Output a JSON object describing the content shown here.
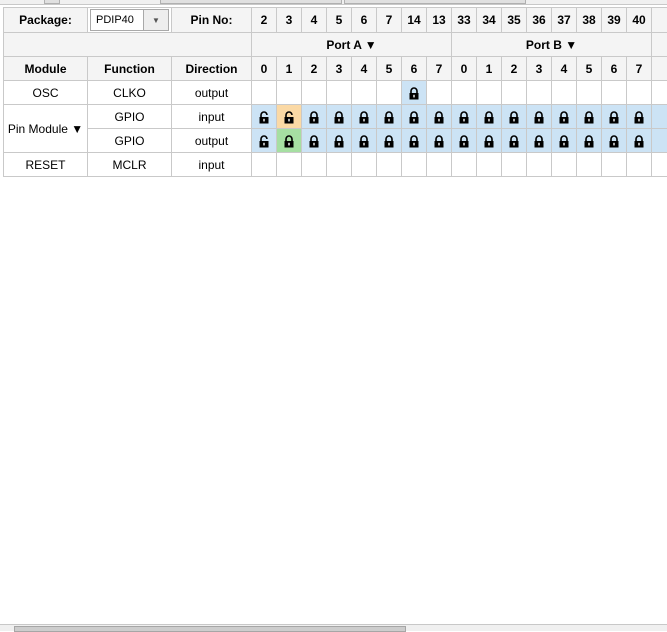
{
  "package": {
    "label": "Package:",
    "value": "PDIP40"
  },
  "pin_no_label": "Pin No:",
  "pins": [
    "2",
    "3",
    "4",
    "5",
    "6",
    "7",
    "14",
    "13",
    "33",
    "34",
    "35",
    "36",
    "37",
    "38",
    "39",
    "40"
  ],
  "ports": [
    {
      "name": "Port A ▼"
    },
    {
      "name": "Port B ▼"
    }
  ],
  "columns": {
    "module": "Module",
    "function": "Function",
    "direction": "Direction"
  },
  "bits": [
    "0",
    "1",
    "2",
    "3",
    "4",
    "5",
    "6",
    "7",
    "0",
    "1",
    "2",
    "3",
    "4",
    "5",
    "6",
    "7"
  ],
  "rows": [
    {
      "module": "OSC",
      "function": "CLKO",
      "direction": "output",
      "cells": [
        "",
        "",
        "",
        "",
        "",
        "",
        "locked",
        "",
        "",
        "",
        "",
        "",
        "",
        "",
        "",
        ""
      ]
    },
    {
      "module": "Pin Module ▼",
      "function": "GPIO",
      "direction": "input",
      "cells": [
        "unlocked",
        "unlocked-orange",
        "locked",
        "locked",
        "locked",
        "locked",
        "locked",
        "locked",
        "locked",
        "locked",
        "locked",
        "locked",
        "locked",
        "locked",
        "locked",
        "locked"
      ]
    },
    {
      "function": "GPIO",
      "direction": "output",
      "cells": [
        "unlocked",
        "locked-green",
        "locked",
        "locked",
        "locked",
        "locked",
        "locked",
        "locked",
        "locked",
        "locked",
        "locked",
        "locked",
        "locked",
        "locked",
        "locked",
        "locked"
      ]
    },
    {
      "module": "RESET",
      "function": "MCLR",
      "direction": "input",
      "cells": [
        "",
        "",
        "",
        "",
        "",
        "",
        "",
        "",
        "",
        "",
        "",
        "",
        "",
        "",
        "",
        ""
      ]
    }
  ]
}
